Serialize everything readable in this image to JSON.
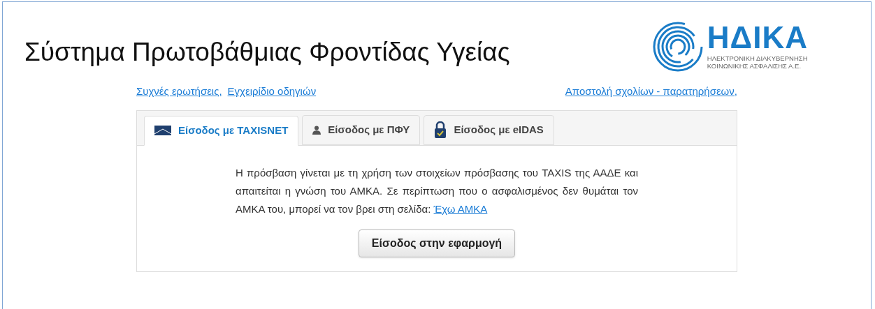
{
  "header": {
    "title": "Σύστημα Πρωτοβάθμιας Φροντίδας Υγείας",
    "logo": {
      "name": "ΗΔΙΚΑ",
      "line_1": "ΗΛΕΚΤΡΟΝΙΚΗ ΔΙΑΚΥΒΕΡΝΗΣΗ",
      "line_2": "ΚΟΙΝΩΝΙΚΗΣ ΑΣΦΑΛΙΣΗΣ Α.Ε."
    }
  },
  "links_left": [
    "Συχνές ερωτήσεις,",
    "Εγχειρίδιο οδηγιών"
  ],
  "links_right": [
    "Αποστολή σχολίων - παρατηρήσεων,"
  ],
  "tabs": [
    {
      "kind": "taxisnet",
      "label": "Είσοδος με TAXISNET",
      "selected": true
    },
    {
      "kind": "user",
      "label": "Είσοδος με ΠΦΥ",
      "selected": false
    },
    {
      "kind": "lock",
      "label": "Είσοδος με eIDAS",
      "selected": false
    }
  ],
  "panel": {
    "text": "Η πρόσβαση γίνεται με τη χρήση των στοιχείων πρόσβασης του TAXIS της ΑΑΔΕ και απαιτείται η γνώση του ΑΜΚΑ. Σε περίπτωση που ο ασφαλισμένος δεν θυμάται τον ΑΜΚΑ του, μπορεί να τον βρει στη σελίδα:",
    "link": "Έχω ΑΜΚΑ",
    "button": "Είσοδος στην εφαρμογή"
  }
}
